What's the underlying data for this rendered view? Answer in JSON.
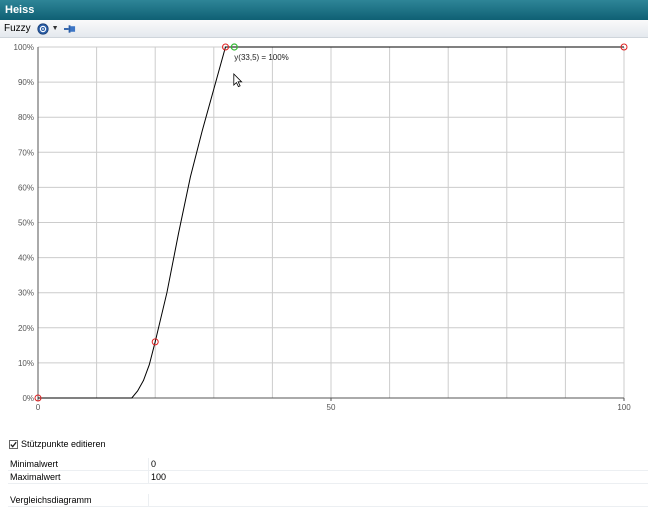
{
  "window": {
    "title": "Heiss"
  },
  "toolbar": {
    "menu_label": "Fuzzy"
  },
  "chart_data": {
    "type": "line",
    "x_ticks": [
      "0",
      "50",
      "100"
    ],
    "y_ticks": [
      "0%",
      "10%",
      "20%",
      "30%",
      "40%",
      "50%",
      "60%",
      "70%",
      "80%",
      "90%",
      "100%"
    ],
    "xlim": [
      0,
      100
    ],
    "ylim": [
      0,
      100
    ],
    "grid": true,
    "curve": [
      [
        0,
        0
      ],
      [
        16,
        0
      ],
      [
        17,
        2
      ],
      [
        18,
        5
      ],
      [
        19,
        9.5
      ],
      [
        20,
        16
      ],
      [
        22,
        30
      ],
      [
        24,
        47
      ],
      [
        26,
        63
      ],
      [
        28,
        76
      ],
      [
        30,
        88
      ],
      [
        32,
        100
      ],
      [
        100,
        100
      ]
    ],
    "support_points": [
      [
        0,
        0
      ],
      [
        20,
        16
      ],
      [
        32,
        100
      ],
      [
        100,
        100
      ]
    ],
    "hover_point": [
      33.5,
      100
    ],
    "hover_label": "y(33,5) = 100%",
    "colors": {
      "curve": "#000000",
      "support_point": "#e02020",
      "hover_point": "#33bb33",
      "grid": "#cccccc"
    }
  },
  "options": {
    "edit_points_label": "Stützpunkte editieren",
    "edit_points_checked": true
  },
  "properties": {
    "min_label": "Minimalwert",
    "min_value": "0",
    "max_label": "Maximalwert",
    "max_value": "100",
    "compare_label": "Vergleichsdiagramm",
    "compare_value": ""
  }
}
